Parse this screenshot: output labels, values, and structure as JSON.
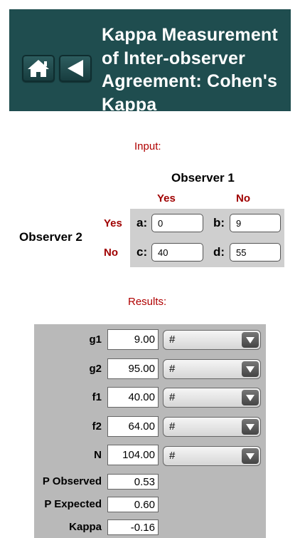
{
  "header": {
    "title_lines": [
      "Kappa Measurement",
      "of Inter-observer",
      "Agreement: Cohen's",
      "Kappa"
    ]
  },
  "input": {
    "section_label": "Input:",
    "observer1_label": "Observer 1",
    "observer2_label": "Observer 2",
    "col_yes": "Yes",
    "col_no": "No",
    "row_yes": "Yes",
    "row_no": "No",
    "cells": [
      {
        "label": "a:",
        "value": "0"
      },
      {
        "label": "b:",
        "value": "9"
      },
      {
        "label": "c:",
        "value": "40"
      },
      {
        "label": "d:",
        "value": "55"
      }
    ]
  },
  "results": {
    "section_label": "Results:",
    "rows": [
      {
        "label": "g1",
        "value": "9.00",
        "unit": "#"
      },
      {
        "label": "g2",
        "value": "95.00",
        "unit": "#"
      },
      {
        "label": "f1",
        "value": "40.00",
        "unit": "#"
      },
      {
        "label": "f2",
        "value": "64.00",
        "unit": "#"
      },
      {
        "label": "N",
        "value": "104.00",
        "unit": "#"
      },
      {
        "label": "P Observed",
        "value": "0.53"
      },
      {
        "label": "P Expected",
        "value": "0.60"
      },
      {
        "label": "Kappa",
        "value": "-0.16"
      }
    ]
  },
  "colors": {
    "header_bg": "#1f4d4f",
    "accent_red": "#b00000"
  },
  "icons": {
    "home": "home-icon",
    "back": "back-arrow-icon"
  }
}
